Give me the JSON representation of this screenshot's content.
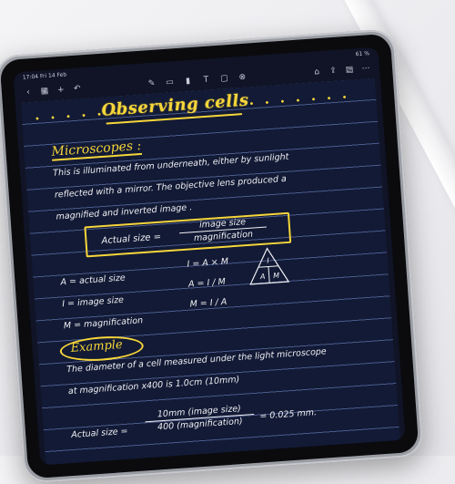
{
  "status": {
    "time": "17:04",
    "date": "Fri 14 Feb",
    "battery": "61 %"
  },
  "note": {
    "title": "Observing cells",
    "dots_left": "• • • • • •",
    "dots_right": "• • • • • • •",
    "heading": "Microscopes :",
    "lines": [
      "This is illuminated from underneath, either by sunlight",
      "reflected with a mirror. The objective lens produced a",
      "magnified and inverted image ."
    ],
    "formula": {
      "label": "Actual size =",
      "numerator": "image size",
      "denominator": "magnification"
    },
    "definitions": [
      "A = actual size",
      "I = image size",
      "M = magnification"
    ],
    "equations": [
      "I = A × M",
      "A = I / M",
      "M = I / A"
    ],
    "triangle": {
      "top": "I",
      "left": "A",
      "right": "M"
    },
    "example_label": "Example",
    "example_lines": [
      "The diameter of a cell measured under the light microscope",
      "at magnification x400 is 1.0cm (10mm)"
    ],
    "calc": {
      "label": "Actual size =",
      "numerator": "10mm (image size)",
      "denominator": "400 (magnification)",
      "result": "= 0.025 mm."
    }
  },
  "icons": {
    "toolbar_left": [
      "back-icon",
      "grid-icon",
      "add-icon",
      "undo-icon"
    ],
    "toolbar_center": [
      "pen-icon",
      "eraser-icon",
      "highlighter-icon",
      "text-icon",
      "image-icon",
      "lasso-icon"
    ],
    "toolbar_right": [
      "bookmark-icon",
      "share-icon",
      "page-icon",
      "more-icon"
    ]
  }
}
